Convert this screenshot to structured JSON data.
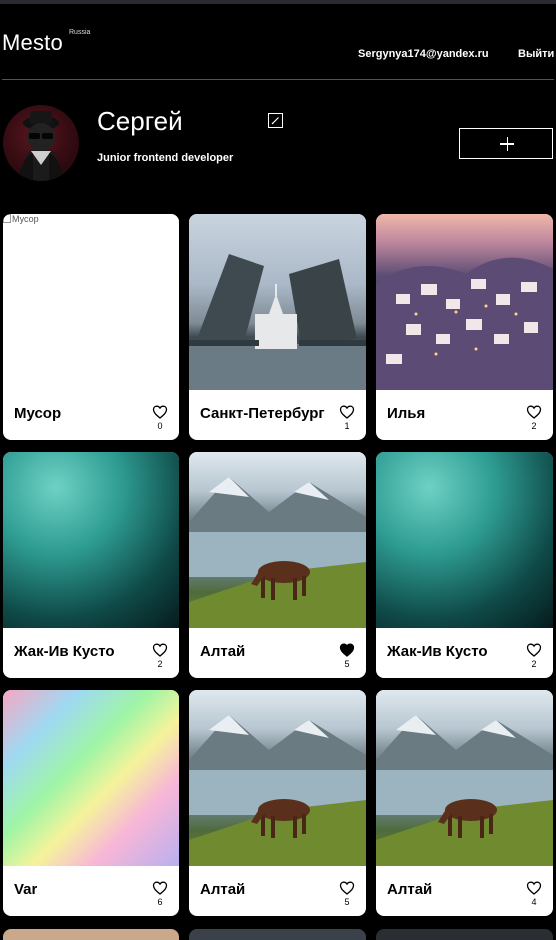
{
  "header": {
    "logo": "Mesto",
    "logo_sub": "Russia",
    "email": "Sergynya174@yandex.ru",
    "logout_label": "Выйти"
  },
  "profile": {
    "name": "Сергей",
    "job": "Junior frontend developer",
    "edit_icon": "pencil-icon",
    "add_icon": "plus-icon"
  },
  "cards": [
    {
      "title": "Мусор",
      "alt": "Мусор",
      "likes": "0",
      "liked": false,
      "image": "broken"
    },
    {
      "title": "Санкт-Петербург",
      "likes": "1",
      "liked": false,
      "image": "city"
    },
    {
      "title": "Илья",
      "likes": "2",
      "liked": false,
      "image": "island"
    },
    {
      "title": "Жак-Ив Кусто",
      "likes": "2",
      "liked": false,
      "image": "water"
    },
    {
      "title": "Алтай",
      "likes": "5",
      "liked": true,
      "image": "altai"
    },
    {
      "title": "Жак-Ив Кусто",
      "likes": "2",
      "liked": false,
      "image": "water"
    },
    {
      "title": "Var",
      "likes": "6",
      "liked": false,
      "image": "rainbow"
    },
    {
      "title": "Алтай",
      "likes": "5",
      "liked": false,
      "image": "altai"
    },
    {
      "title": "Алтай",
      "likes": "4",
      "liked": false,
      "image": "altai"
    }
  ]
}
